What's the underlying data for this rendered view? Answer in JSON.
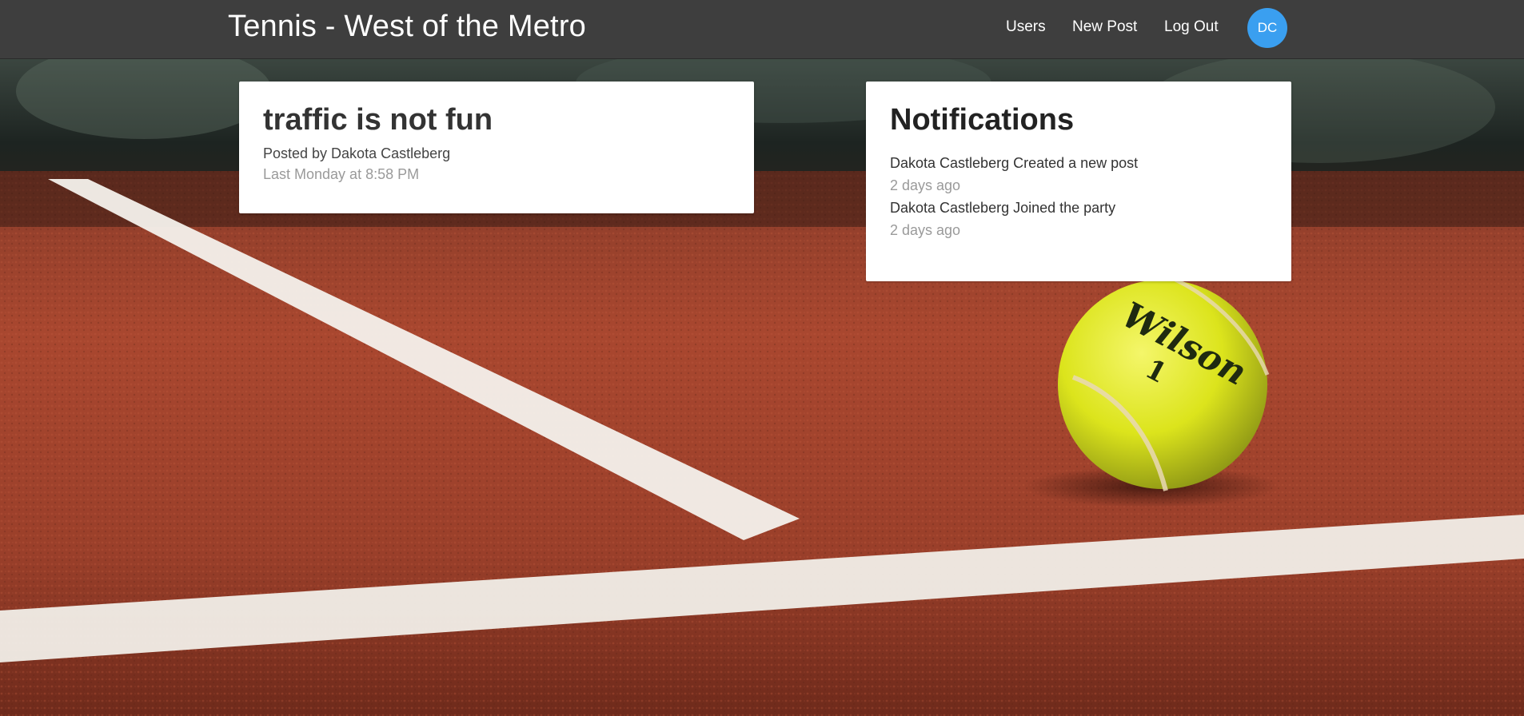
{
  "navbar": {
    "brand": "Tennis - West of the Metro",
    "links": {
      "users": "Users",
      "new_post": "New Post",
      "log_out": "Log Out"
    },
    "avatar_initials": "DC"
  },
  "post": {
    "title": "traffic is not fun",
    "author": "Posted by Dakota Castleberg",
    "time": "Last Monday at 8:58 PM"
  },
  "notifications": {
    "title": "Notifications",
    "items": [
      {
        "text": "Dakota Castleberg Created a new post",
        "time": "2 days ago"
      },
      {
        "text": "Dakota Castleberg Joined the party",
        "time": "2 days ago"
      }
    ]
  },
  "background": {
    "ball_brand": "Wilson",
    "ball_number": "1"
  },
  "colors": {
    "navbar": "#3e3e3e",
    "avatar": "#3a9ff0",
    "court": "#a8412c",
    "line": "#f4f1ec",
    "ball": "#dfe51f"
  }
}
